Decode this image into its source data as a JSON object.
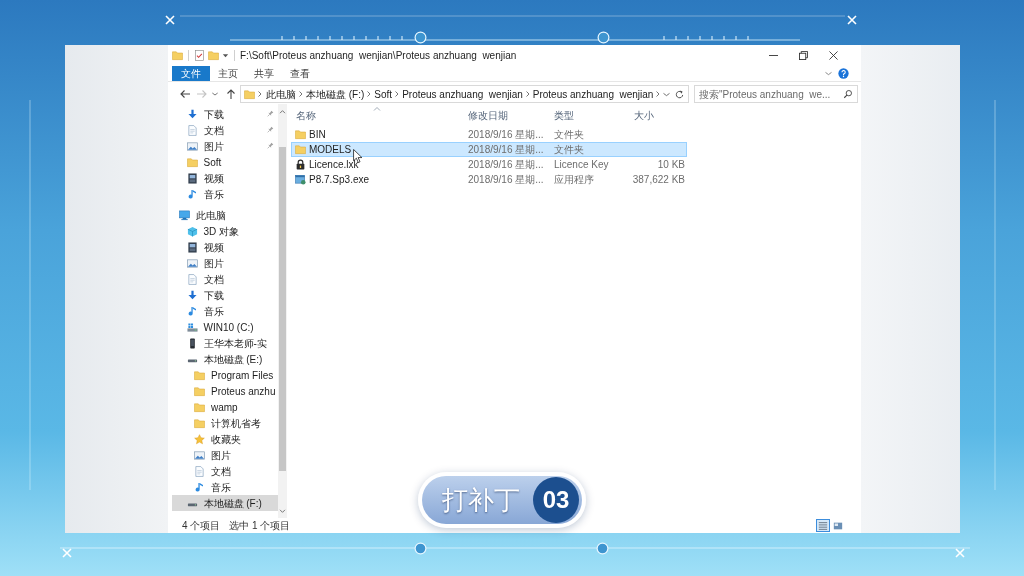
{
  "window": {
    "title": "F:\\Soft\\Proteus anzhuang  wenjian\\Proteus anzhuang  wenjian"
  },
  "ribbon": {
    "tabs": [
      {
        "label": "文件",
        "selected": true
      },
      {
        "label": "主页",
        "selected": false
      },
      {
        "label": "共享",
        "selected": false
      },
      {
        "label": "查看",
        "selected": false
      }
    ]
  },
  "address_bar": {
    "breadcrumbs": [
      "此电脑",
      "本地磁盘 (F:)",
      "Soft",
      "Proteus anzhuang  wenjian",
      "Proteus anzhuang  wenjian"
    ],
    "search": {
      "placeholder": "搜索\"Proteus anzhuang  we..."
    }
  },
  "navigation": {
    "quick_access": [
      {
        "label": "下载",
        "kind": "download",
        "pinned": true,
        "selected": false
      },
      {
        "label": "文档",
        "kind": "document",
        "pinned": true,
        "selected": false
      },
      {
        "label": "图片",
        "kind": "picture",
        "pinned": true,
        "selected": false
      },
      {
        "label": "Soft",
        "kind": "folder",
        "pinned": false,
        "selected": false
      },
      {
        "label": "视频",
        "kind": "video",
        "pinned": false,
        "selected": false
      },
      {
        "label": "音乐",
        "kind": "music",
        "pinned": false,
        "selected": false
      }
    ],
    "tree": [
      {
        "label": "此电脑",
        "kind": "computer",
        "selected": false,
        "children": [
          {
            "label": "3D 对象",
            "kind": "object3d",
            "selected": false
          },
          {
            "label": "视频",
            "kind": "video",
            "selected": false
          },
          {
            "label": "图片",
            "kind": "picture",
            "selected": false
          },
          {
            "label": "文档",
            "kind": "document",
            "selected": false
          },
          {
            "label": "下载",
            "kind": "download",
            "selected": false
          },
          {
            "label": "音乐",
            "kind": "music",
            "selected": false
          },
          {
            "label": "WIN10 (C:)",
            "kind": "system-drive",
            "selected": false
          },
          {
            "label": "王华本老师-实",
            "kind": "device",
            "selected": false
          },
          {
            "label": "本地磁盘 (E:)",
            "kind": "drive",
            "selected": false,
            "children": [
              {
                "label": "Program Files",
                "kind": "folder",
                "selected": false
              },
              {
                "label": "Proteus anzhu",
                "kind": "folder",
                "selected": false
              },
              {
                "label": "wamp",
                "kind": "folder",
                "selected": false
              },
              {
                "label": "计算机省考",
                "kind": "folder",
                "selected": false
              },
              {
                "label": "收藏夹",
                "kind": "star",
                "selected": false
              },
              {
                "label": "图片",
                "kind": "picture",
                "selected": false
              },
              {
                "label": "文档",
                "kind": "document",
                "selected": false
              },
              {
                "label": "音乐",
                "kind": "music",
                "selected": false
              }
            ]
          },
          {
            "label": "本地磁盘 (F:)",
            "kind": "drive",
            "selected": true
          }
        ]
      }
    ]
  },
  "files": {
    "columns": [
      {
        "label": "名称",
        "sorted": true
      },
      {
        "label": "修改日期",
        "sorted": false
      },
      {
        "label": "类型",
        "sorted": false
      },
      {
        "label": "大小",
        "sorted": false
      }
    ],
    "rows": [
      {
        "name": "BIN",
        "kind": "folder",
        "modified": "2018/9/16 星期...",
        "type": "文件夹",
        "selected": false
      },
      {
        "name": "MODELS",
        "kind": "folder",
        "modified": "2018/9/16 星期...",
        "type": "文件夹",
        "selected": true
      },
      {
        "name": "Licence.lxk",
        "kind": "key",
        "modified": "2018/9/16 星期...",
        "type": "Licence Key",
        "size": "10 KB",
        "selected": false
      },
      {
        "name": "P8.7.Sp3.exe",
        "kind": "exe",
        "modified": "2018/9/16 星期...",
        "type": "应用程序",
        "size": "387,622 KB",
        "selected": false
      }
    ]
  },
  "status_bar": {
    "item_count": "4 个项目",
    "selection": "选中 1 个项目",
    "views": [
      {
        "kind": "details",
        "selected": true
      },
      {
        "kind": "tiles",
        "selected": false
      }
    ]
  },
  "badge": {
    "label": "打补丁",
    "number": "03"
  }
}
